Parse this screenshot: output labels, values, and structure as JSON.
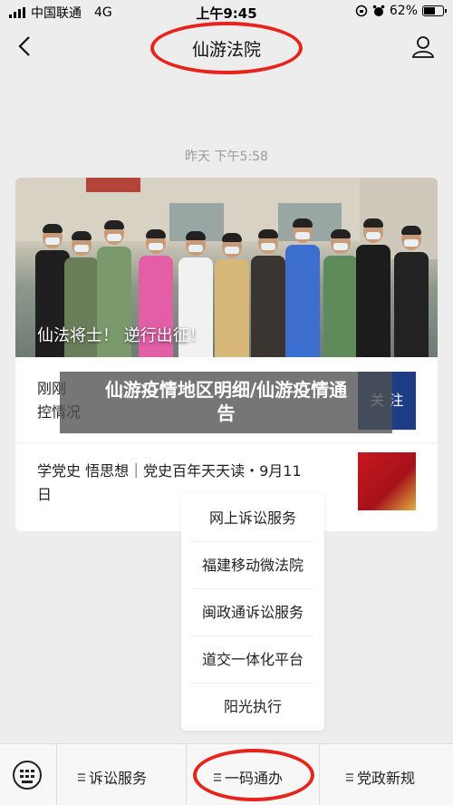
{
  "status_bar": {
    "carrier": "中国联通",
    "network": "4G",
    "time": "上午9:45",
    "battery": "62%",
    "battery_level": 0.62
  },
  "nav": {
    "title": "仙游法院"
  },
  "timestamp": "昨天 下午5:58",
  "article_card": {
    "cover_caption": "仙法将士！ 逆行出征！",
    "articles": [
      {
        "title": "刚刚！…控情况",
        "title_line1": "刚刚",
        "title_line2": "控情况",
        "thumb_text": "关 注"
      },
      {
        "title_line1": "学党史 悟思想｜党史百年天天读・9月11",
        "title_line2": "日"
      }
    ]
  },
  "overlay_banner": {
    "line1": "仙游疫情地区明细/仙游疫情通",
    "line2": "告"
  },
  "popup_menu": {
    "items": [
      "网上诉讼服务",
      "福建移动微法院",
      "闽政通诉讼服务",
      "道交一体化平台",
      "阳光执行"
    ]
  },
  "bottom_bar": {
    "items": [
      "诉讼服务",
      "一码通办",
      "党政新规"
    ]
  },
  "colors": {
    "highlight_circle": "#e8231b",
    "background": "#ededed"
  }
}
